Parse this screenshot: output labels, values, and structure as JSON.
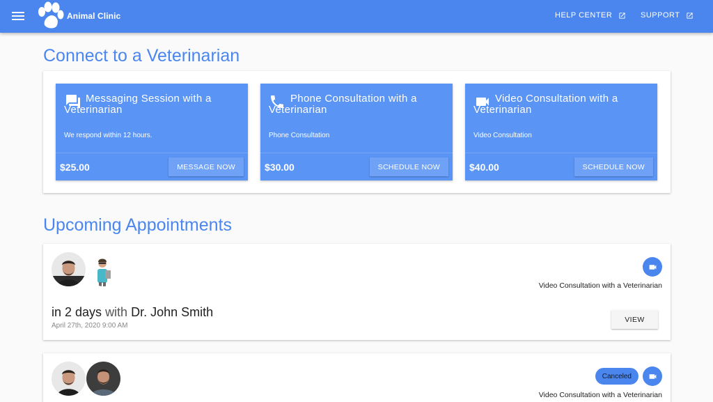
{
  "header": {
    "brand": "Animal Clinic",
    "links": [
      {
        "label": "HELP CENTER"
      },
      {
        "label": "SUPPORT"
      }
    ]
  },
  "consult": {
    "heading": "Connect to a Veterinarian",
    "cards": [
      {
        "title": "Messaging Session with a Veterinarian",
        "desc": "We respond within 12 hours.",
        "price": "$25.00",
        "button": "MESSAGE NOW",
        "icon": "chat-icon"
      },
      {
        "title": "Phone Consultation with a Veterinarian",
        "desc": "Phone Consultation",
        "price": "$30.00",
        "button": "SCHEDULE NOW",
        "icon": "phone-icon"
      },
      {
        "title": "Video Consultation with a Veterinarian",
        "desc": "Video Consultation",
        "price": "$40.00",
        "button": "SCHEDULE NOW",
        "icon": "videocam-icon"
      }
    ]
  },
  "appointments": {
    "heading": "Upcoming Appointments",
    "items": [
      {
        "type": "Video Consultation with a Veterinarian",
        "when": "in 2 days",
        "with_word": "with",
        "doctor": "Dr. John Smith",
        "date": "April 27th, 2020 9:00 AM",
        "button": "VIEW"
      },
      {
        "type": "Video Consultation with a Veterinarian",
        "status": "Canceled"
      }
    ]
  },
  "colors": {
    "primary": "#4a86ee",
    "card": "#5a94f4",
    "background": "#fafafa"
  }
}
